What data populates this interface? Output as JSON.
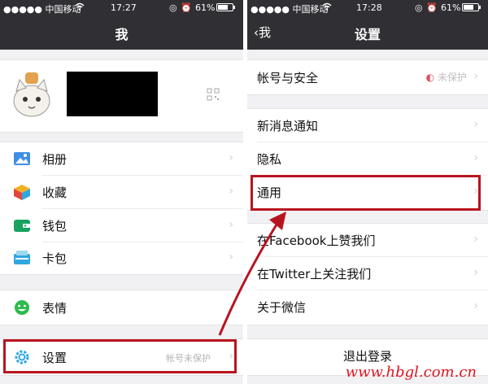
{
  "colors": {
    "navbar": "#2f2f34",
    "highlight": "#b8141f",
    "watermark": "#e0141e"
  },
  "left": {
    "status": {
      "carrier": "●●●●● 中国移动",
      "time": "17:27",
      "battery": "61%"
    },
    "title": "我",
    "profile": {
      "qr_icon": "qr-code-icon"
    },
    "items": [
      {
        "label": "相册",
        "icon": "album-icon"
      },
      {
        "label": "收藏",
        "icon": "favorites-icon"
      },
      {
        "label": "钱包",
        "icon": "wallet-icon"
      },
      {
        "label": "卡包",
        "icon": "card-package-icon"
      },
      {
        "label": "表情",
        "icon": "emoji-icon"
      }
    ],
    "settings": {
      "label": "设置",
      "hint": "帐号未保护",
      "icon": "gear-icon"
    }
  },
  "right": {
    "status": {
      "carrier": "●●●●● 中国移动",
      "time": "17:28",
      "battery": "61%"
    },
    "back_label": "我",
    "title": "设置",
    "account": {
      "label": "帐号与安全",
      "hint": "未保护"
    },
    "items": [
      {
        "label": "新消息通知"
      },
      {
        "label": "隐私"
      },
      {
        "label": "通用"
      },
      {
        "label": "在Facebook上赞我们"
      },
      {
        "label": "在Twitter上关注我们"
      },
      {
        "label": "关于微信"
      }
    ],
    "logout": "退出登录"
  },
  "watermark": "www.hbgl.com.cn"
}
